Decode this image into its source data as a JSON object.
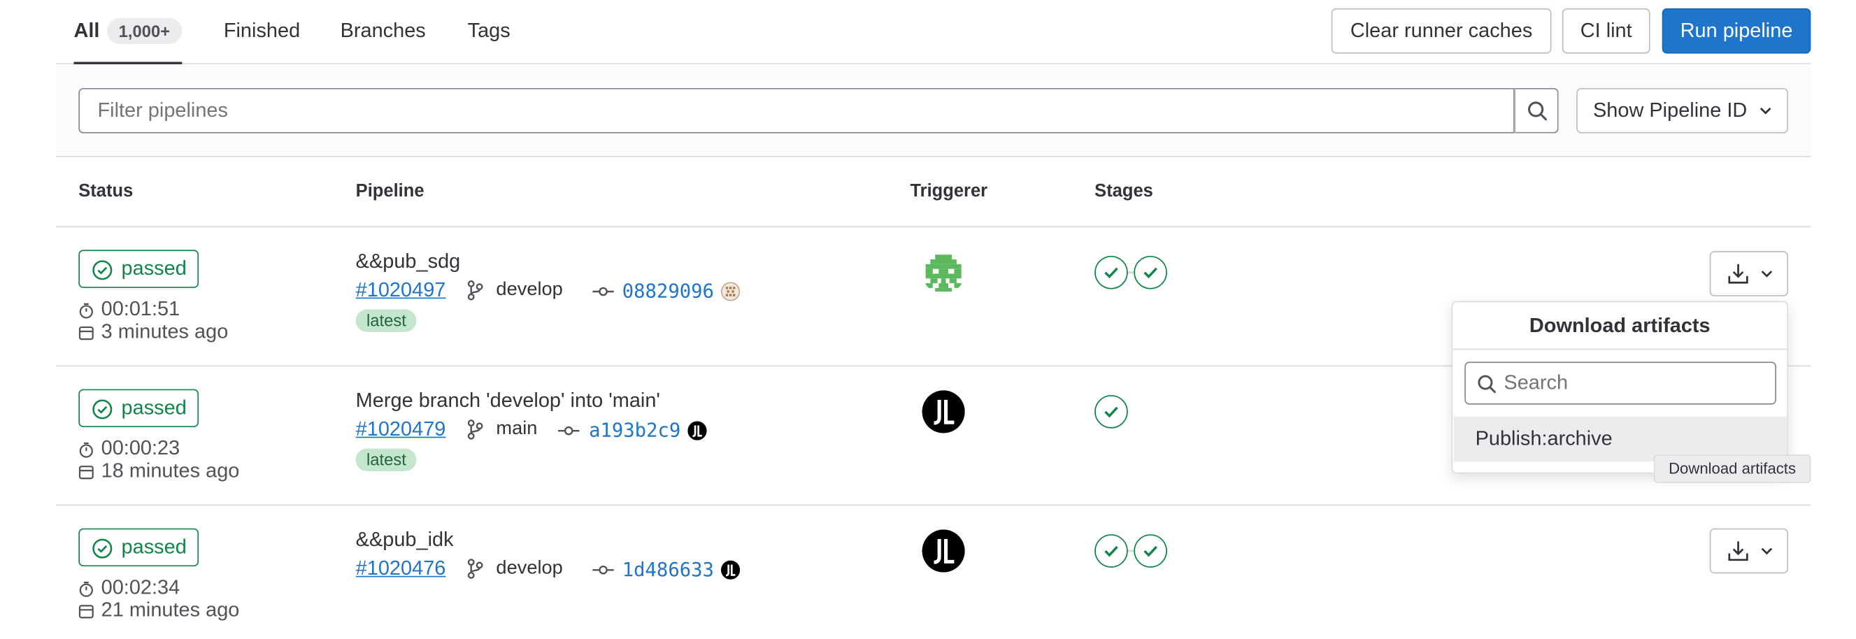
{
  "tabs": [
    {
      "label": "All",
      "count": "1,000+"
    },
    {
      "label": "Finished"
    },
    {
      "label": "Branches"
    },
    {
      "label": "Tags"
    }
  ],
  "actions": {
    "clear_caches": "Clear runner caches",
    "ci_lint": "CI lint",
    "run_pipeline": "Run pipeline"
  },
  "filter": {
    "placeholder": "Filter pipelines",
    "id_select": "Show Pipeline ID"
  },
  "columns": {
    "status": "Status",
    "pipeline": "Pipeline",
    "triggerer": "Triggerer",
    "stages": "Stages"
  },
  "pipelines": [
    {
      "status": "passed",
      "duration": "00:01:51",
      "finished": "3 minutes ago",
      "title": "&&pub_sdg",
      "id": "#1020497",
      "ref": "develop",
      "sha": "08829096",
      "tag": "latest",
      "triggerer_avatar": "green-pixel-avatar",
      "stages": 2
    },
    {
      "status": "passed",
      "duration": "00:00:23",
      "finished": "18 minutes ago",
      "title": "Merge branch 'develop' into 'main'",
      "id": "#1020479",
      "ref": "main",
      "sha": "a193b2c9",
      "tag": "latest",
      "triggerer_avatar": "jl-avatar",
      "stages": 1
    },
    {
      "status": "passed",
      "duration": "00:02:34",
      "finished": "21 minutes ago",
      "title": "&&pub_idk",
      "id": "#1020476",
      "ref": "develop",
      "sha": "1d486633",
      "triggerer_avatar": "jl-avatar",
      "stages": 2
    }
  ],
  "artifacts_dropdown": {
    "title": "Download artifacts",
    "search_placeholder": "Search",
    "items": [
      "Publish:archive"
    ]
  },
  "tooltip": "Download artifacts",
  "colors": {
    "primary": "#1f75cb",
    "success": "#108548",
    "latest_bg": "#c3e6cd"
  }
}
